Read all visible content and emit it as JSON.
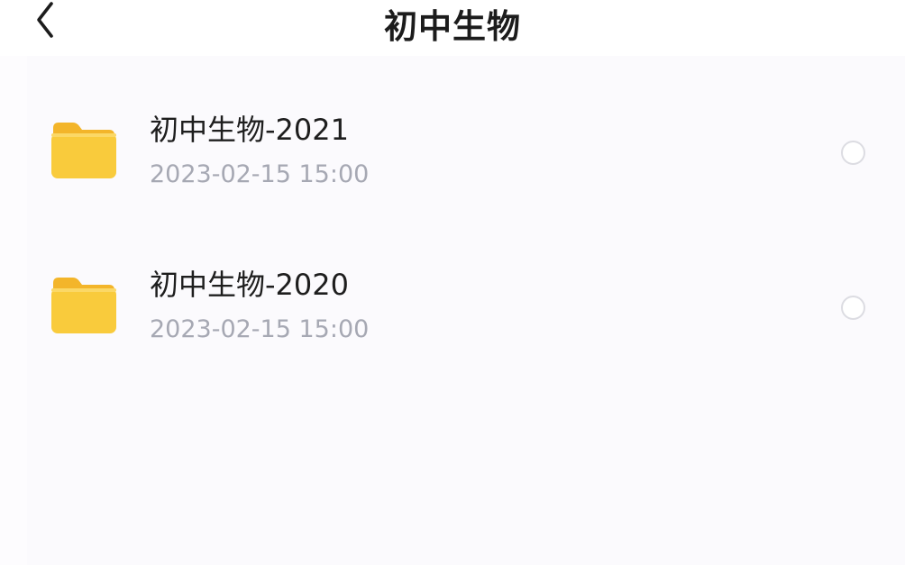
{
  "header": {
    "back_icon": "chevron-left-icon",
    "title": "初中生物"
  },
  "folders": [
    {
      "name": "初中生物-2021",
      "date": "2023-02-15 15:00",
      "icon": "folder-icon",
      "selected": false
    },
    {
      "name": "初中生物-2020",
      "date": "2023-02-15 15:00",
      "icon": "folder-icon",
      "selected": false
    }
  ],
  "colors": {
    "folder_body": "#f9cb3c",
    "folder_tab": "#f3b52a",
    "title_text": "#1c1c1c",
    "secondary_text": "#a6a8b3",
    "radio_border": "#dcdce2"
  }
}
